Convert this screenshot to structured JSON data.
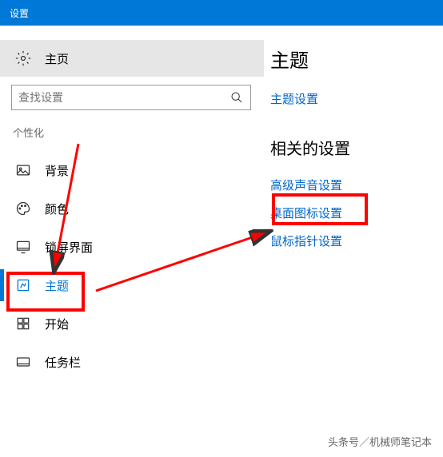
{
  "titlebar": {
    "title": "设置"
  },
  "sidebar": {
    "home_label": "主页",
    "search_placeholder": "查找设置",
    "section_label": "个性化",
    "items": [
      {
        "label": "背景"
      },
      {
        "label": "颜色"
      },
      {
        "label": "锁屏界面"
      },
      {
        "label": "主题"
      },
      {
        "label": "开始"
      },
      {
        "label": "任务栏"
      }
    ]
  },
  "main": {
    "title": "主题",
    "theme_settings_link": "主题设置",
    "related_title": "相关的设置",
    "links": [
      "高级声音设置",
      "桌面图标设置",
      "鼠标指针设置"
    ]
  },
  "attribution": "头条号／机械师笔记本"
}
